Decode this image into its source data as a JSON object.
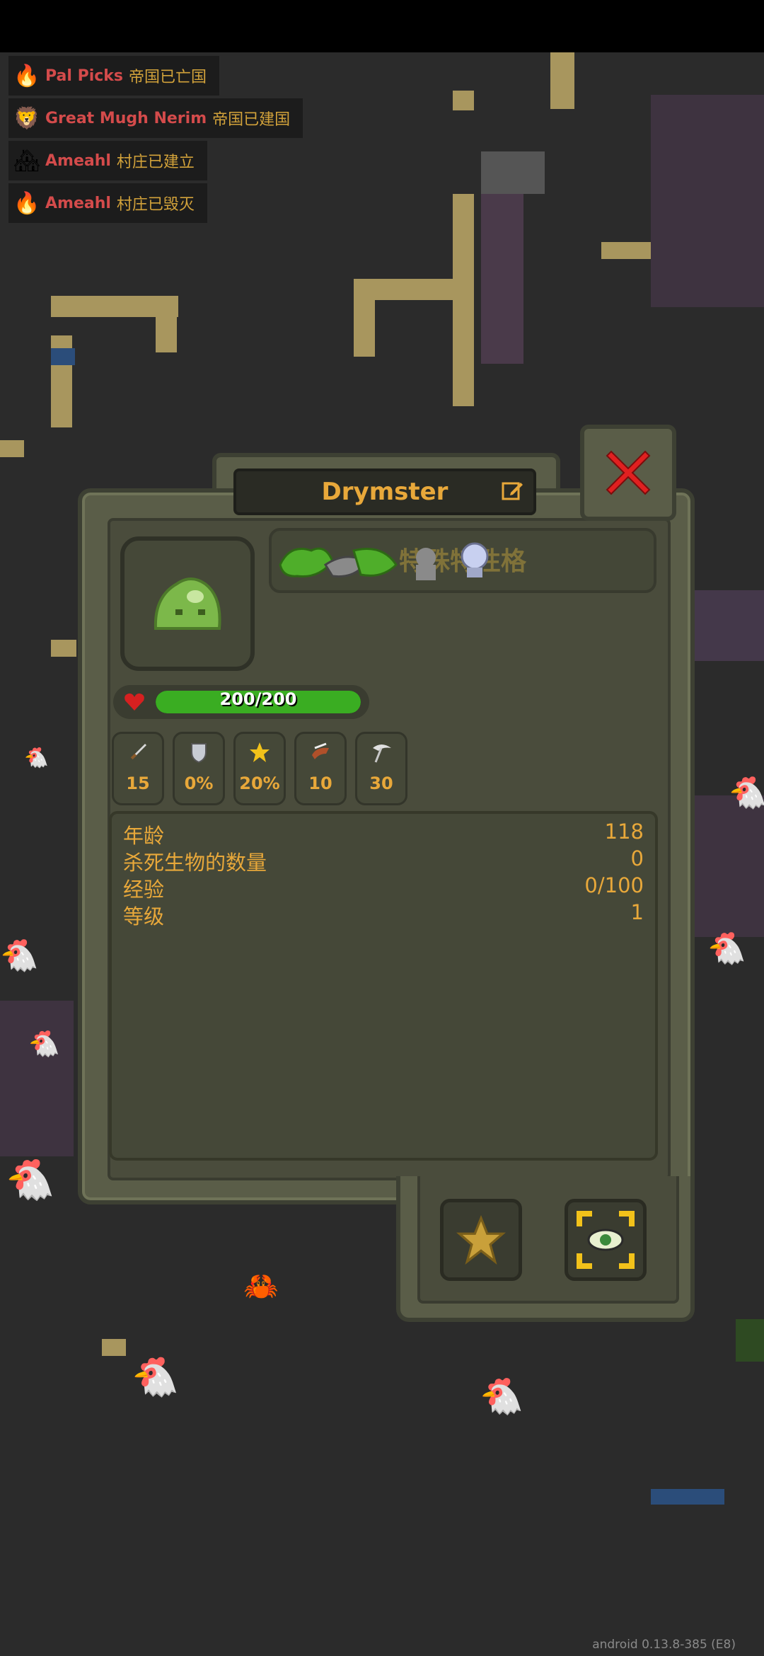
{
  "feed": [
    {
      "name": "Pal Picks",
      "msg": "帝国已亡国",
      "icon": "fire-icon"
    },
    {
      "name": "Great Mugh Nerim",
      "msg": "帝国已建国",
      "icon": "lion-icon"
    },
    {
      "name": "Ameahl",
      "msg": "村庄已建立",
      "icon": "house-icon"
    },
    {
      "name": "Ameahl",
      "msg": "村庄已毁灭",
      "icon": "fire-icon"
    }
  ],
  "unit": {
    "name": "Drymster",
    "traits_label": "特殊特性格",
    "health": {
      "text": "200/200",
      "fraction": 1.0
    },
    "stats": [
      {
        "icon": "sword-icon",
        "value": "15"
      },
      {
        "icon": "shield-icon",
        "value": "0%"
      },
      {
        "icon": "crit-star-icon",
        "value": "20%"
      },
      {
        "icon": "speed-boot-icon",
        "value": "10"
      },
      {
        "icon": "scythe-icon",
        "value": "30"
      }
    ],
    "info": [
      {
        "label": "年龄",
        "value": "118"
      },
      {
        "label": "杀死生物的数量",
        "value": "0"
      },
      {
        "label": "经验",
        "value": "0/100"
      },
      {
        "label": "等级",
        "value": "1"
      }
    ]
  },
  "version": "android 0.13.8-385 (E8)",
  "colors": {
    "accent": "#e8a83a",
    "health": "#3aad22",
    "close": "#e02020",
    "feed_name": "#d44b4b"
  }
}
